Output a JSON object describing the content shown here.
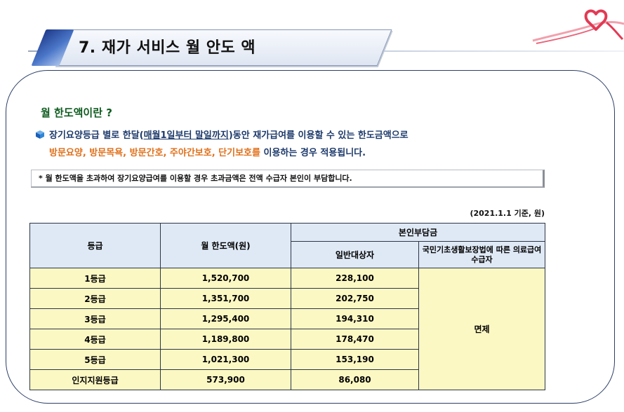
{
  "header": {
    "title": "7. 재가 서비스 월 안도 액"
  },
  "section": {
    "title": "월 한도액이란 ?",
    "desc_line1_pre": "장기요양등급 별로 한달(",
    "desc_line1_underlined": "매월1일부터 말일까지",
    "desc_line1_post": ")동안 재가급여를 이용할 수 있는 한도금액으로",
    "desc_line2_highlight": "방문요양, 방문목욕, 방문간호, 주야간보호, 단기보호를",
    "desc_line2_post": " 이용하는 경우 적용됩니다."
  },
  "notice": "* 월 한도액을 초과하여 장기요양급여를 이용할 경우 초과금액은 전액 수급자 본인이 부담합니다.",
  "basis": "(2021.1.1 기준, 원)",
  "table": {
    "headers": {
      "grade": "등급",
      "limit": "월 한도액(원)",
      "copay": "본인부담금",
      "general": "일반대상자",
      "medical": "국민기초생활보장법에 따른 의료급여 수급자"
    },
    "exempt": "면제",
    "rows": [
      {
        "grade": "1등급",
        "limit": "1,520,700",
        "general": "228,100"
      },
      {
        "grade": "2등급",
        "limit": "1,351,700",
        "general": "202,750"
      },
      {
        "grade": "3등급",
        "limit": "1,295,400",
        "general": "194,310"
      },
      {
        "grade": "4등급",
        "limit": "1,189,800",
        "general": "178,470"
      },
      {
        "grade": "5등급",
        "limit": "1,021,300",
        "general": "153,190"
      },
      {
        "grade": "인지지원등급",
        "limit": "573,900",
        "general": "86,080"
      }
    ]
  },
  "colors": {
    "title_green": "#0e5b1f",
    "text_navy": "#1d3a6b",
    "highlight_orange": "#e0701b",
    "header_cell": "#dfe9f6",
    "body_cell": "#fcf8c4"
  }
}
